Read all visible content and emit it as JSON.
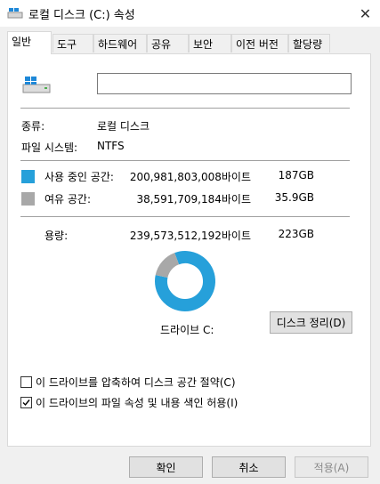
{
  "window": {
    "title": "로컬 디스크 (C:) 속성",
    "close_symbol": "✕"
  },
  "tabs": [
    {
      "label": "일반",
      "active": true
    },
    {
      "label": "도구"
    },
    {
      "label": "하드웨어"
    },
    {
      "label": "공유"
    },
    {
      "label": "보안"
    },
    {
      "label": "이전 버전"
    },
    {
      "label": "할당량"
    }
  ],
  "general": {
    "name_value": "",
    "type_label": "종류:",
    "type_value": "로컬 디스크",
    "fs_label": "파일 시스템:",
    "fs_value": "NTFS",
    "used_label": "사용 중인 공간:",
    "used_bytes": "200,981,803,008바이트",
    "used_size": "187GB",
    "free_label": "여유 공간:",
    "free_bytes": "38,591,709,184바이트",
    "free_size": "35.9GB",
    "capacity_label": "용량:",
    "capacity_bytes": "239,573,512,192바이트",
    "capacity_size": "223GB",
    "drive_label": "드라이브 C:",
    "cleanup_button": "디스크 정리(D)",
    "compress_checkbox": "이 드라이브를 압축하여 디스크 공간 절약(C)",
    "compress_checked": false,
    "index_checkbox": "이 드라이브의 파일 속성 및 내용 색인 허용(I)",
    "index_checked": true
  },
  "colors": {
    "used": "#26a0da",
    "free": "#a8a8a8"
  },
  "chart_data": {
    "type": "pie",
    "categories": [
      "사용 중인 공간",
      "여유 공간"
    ],
    "values": [
      200981803008,
      38591709184
    ]
  },
  "footer": {
    "ok": "확인",
    "cancel": "취소",
    "apply": "적용(A)"
  }
}
